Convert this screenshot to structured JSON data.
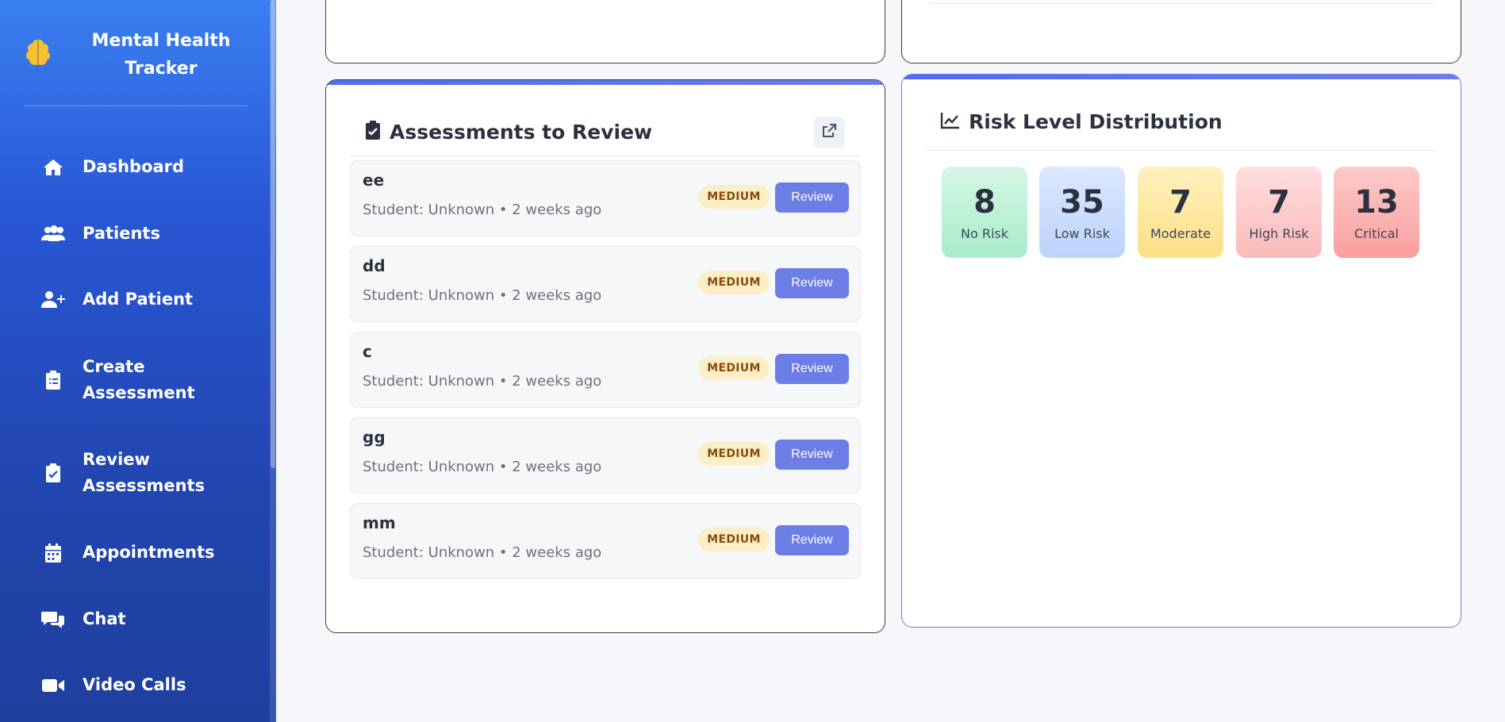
{
  "brand": {
    "name": "Mental Health Tracker",
    "logo_icon": "brain-icon"
  },
  "nav": [
    {
      "label": "Dashboard",
      "icon": "home-icon"
    },
    {
      "label": "Patients",
      "icon": "users-icon"
    },
    {
      "label": "Add Patient",
      "icon": "user-plus-icon"
    },
    {
      "label": "Create Assessment",
      "icon": "clipboard-list-icon"
    },
    {
      "label": "Review Assessments",
      "icon": "clipboard-check-icon"
    },
    {
      "label": "Appointments",
      "icon": "calendar-icon"
    },
    {
      "label": "Chat",
      "icon": "comments-icon"
    },
    {
      "label": "Video Calls",
      "icon": "video-icon"
    }
  ],
  "assessments": {
    "title": "Assessments to Review",
    "title_icon": "clipboard-check-icon",
    "open_icon": "external-link-icon",
    "items": [
      {
        "title": "ee",
        "meta": "Student: Unknown • 2 weeks ago",
        "badge": "MEDIUM",
        "action": "Review"
      },
      {
        "title": "dd",
        "meta": "Student: Unknown • 2 weeks ago",
        "badge": "MEDIUM",
        "action": "Review"
      },
      {
        "title": "c",
        "meta": "Student: Unknown • 2 weeks ago",
        "badge": "MEDIUM",
        "action": "Review"
      },
      {
        "title": "gg",
        "meta": "Student: Unknown • 2 weeks ago",
        "badge": "MEDIUM",
        "action": "Review"
      },
      {
        "title": "mm",
        "meta": "Student: Unknown • 2 weeks ago",
        "badge": "MEDIUM",
        "action": "Review"
      }
    ]
  },
  "risk": {
    "title": "Risk Level Distribution",
    "title_icon": "chart-line-icon",
    "levels": [
      {
        "value": "8",
        "label": "No Risk",
        "color_from": "#d5f7e6",
        "color_to": "#a9ecc9"
      },
      {
        "value": "35",
        "label": "Low Risk",
        "color_from": "#dbe8ff",
        "color_to": "#bcd3fb"
      },
      {
        "value": "7",
        "label": "Moderate",
        "color_from": "#fff1bf",
        "color_to": "#fcdf86"
      },
      {
        "value": "7",
        "label": "High Risk",
        "color_from": "#ffdede",
        "color_to": "#fbbaba"
      },
      {
        "value": "13",
        "label": "Critical",
        "color_from": "#fecaca",
        "color_to": "#fa9f9f"
      }
    ]
  },
  "colors": {
    "accent": "#6c7ee6",
    "sidebar": "#2856d4",
    "badge_bg": "#fcefc7",
    "badge_fg": "#8a4b08"
  }
}
